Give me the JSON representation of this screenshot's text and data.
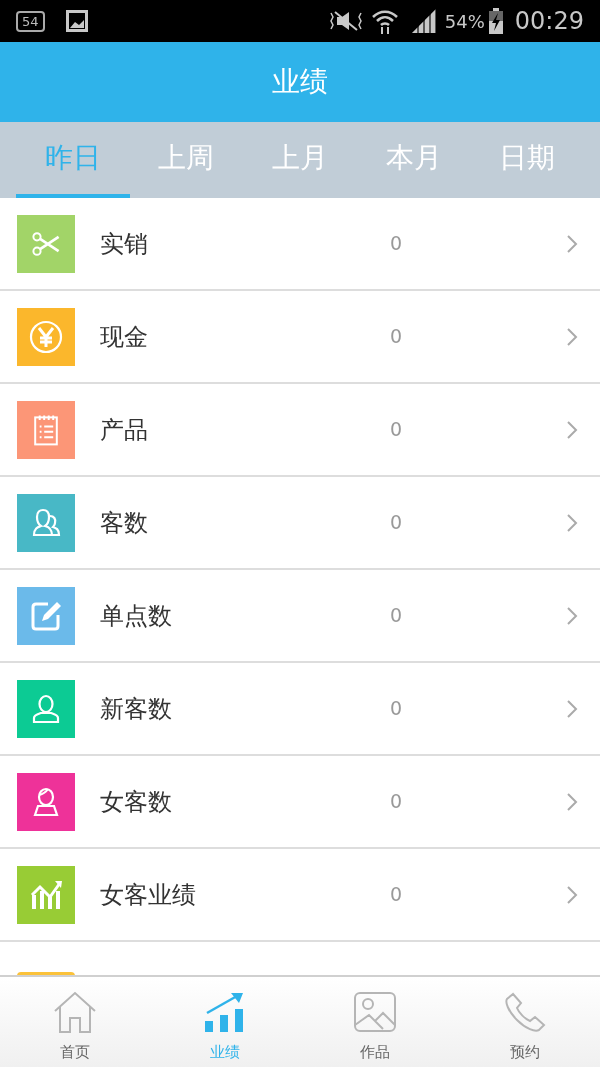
{
  "status_bar": {
    "notification_badge": "54",
    "battery_percent": "54%",
    "time": "00:29"
  },
  "header": {
    "title": "业绩"
  },
  "tabs": [
    {
      "label": "昨日",
      "selected": true
    },
    {
      "label": "上周",
      "selected": false
    },
    {
      "label": "上月",
      "selected": false
    },
    {
      "label": "本月",
      "selected": false
    },
    {
      "label": "日期",
      "selected": false
    }
  ],
  "rows": [
    {
      "kind": "full",
      "label": "实销",
      "value": "0",
      "color": "#a2d468"
    },
    {
      "kind": "full",
      "label": "现金",
      "value": "0",
      "color": "#fbb72c"
    },
    {
      "kind": "full",
      "label": "产品",
      "value": "0",
      "color": "#fc9677"
    },
    {
      "kind": "full",
      "label": "客数",
      "value": "0",
      "color": "#48b8c6"
    },
    {
      "kind": "full",
      "label": "单点数",
      "value": "0",
      "color": "#6bbaea"
    },
    {
      "kind": "full",
      "label": "新客数",
      "value": "0",
      "color": "#0ccb94"
    },
    {
      "kind": "full",
      "label": "女客数",
      "value": "0",
      "color": "#ee3299"
    },
    {
      "kind": "full",
      "label": "女客业绩",
      "value": "0",
      "color": "#98cc35"
    },
    {
      "kind": "partial",
      "color": "#fbc23a"
    }
  ],
  "bottom_nav": [
    {
      "label": "首页",
      "selected": false
    },
    {
      "label": "业绩",
      "selected": true
    },
    {
      "label": "作品",
      "selected": false
    },
    {
      "label": "预约",
      "selected": false
    }
  ]
}
